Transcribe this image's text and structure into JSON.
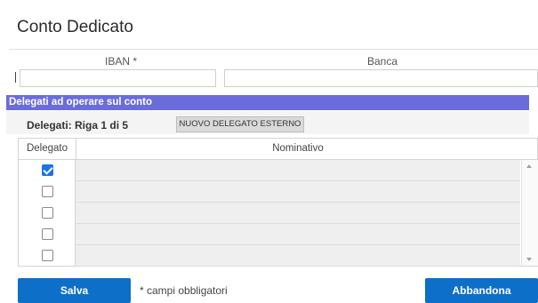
{
  "dialog": {
    "title": "Conto Dedicato"
  },
  "form": {
    "iban_label": "IBAN *",
    "iban_value": "",
    "banca_label": "Banca",
    "banca_value": ""
  },
  "delegati": {
    "section_title": "Delegati ad operare sul conto",
    "count_text": "Delegati: Riga 1 di 5",
    "new_button": "NUOVO DELEGATO ESTERNO",
    "columns": [
      "Delegato",
      "Nominativo"
    ],
    "rows": [
      {
        "checked": true,
        "nominativo": ""
      },
      {
        "checked": false,
        "nominativo": ""
      },
      {
        "checked": false,
        "nominativo": ""
      },
      {
        "checked": false,
        "nominativo": ""
      },
      {
        "checked": false,
        "nominativo": ""
      }
    ]
  },
  "footer": {
    "save_label": "Salva",
    "required_note": "* campi obbligatori",
    "cancel_label": "Abbandona"
  },
  "colors": {
    "section_bar": "#6b6cdc",
    "primary_button": "#0e6fc9",
    "checkbox_checked": "#1a73e8"
  }
}
